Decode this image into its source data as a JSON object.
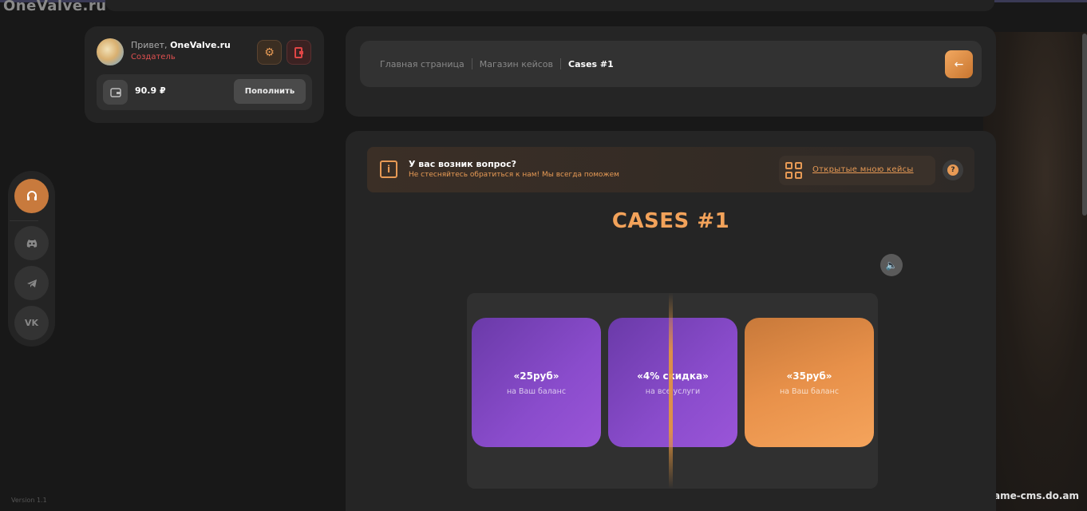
{
  "site": {
    "title": "OneValve.ru",
    "watermark": "game-cms.do.am",
    "version": "Version 1.1"
  },
  "user": {
    "greeting": "Привет,",
    "name": "OneValve.ru",
    "role": "Создатель",
    "balance": "90.9 ₽",
    "topup_label": "Пополнить"
  },
  "rail": {
    "items": [
      "headset-icon",
      "discord-icon",
      "telegram-icon",
      "vk-icon"
    ]
  },
  "breadcrumbs": [
    "Главная страница",
    "Магазин кейсов",
    "Cases #1"
  ],
  "info": {
    "title": "У вас возник вопрос?",
    "subtitle": "Не стесняйтесь обратиться к нам! Мы всегда поможем",
    "open_cases_link": "Открытые мною кейсы"
  },
  "case": {
    "title": "CASES #1",
    "items": [
      {
        "name": "«25руб»",
        "desc": "на Ваш баланс",
        "color": "#8a4ccc"
      },
      {
        "name": "«4% скидка»",
        "desc": "на все услуги",
        "color": "#8a4ccc"
      },
      {
        "name": "«35руб»",
        "desc": "на Ваш баланс",
        "color": "#e8914a"
      }
    ]
  },
  "colors": {
    "accent": "#e79a55",
    "danger": "#e05050",
    "bg": "#181818",
    "panel": "#252525"
  }
}
